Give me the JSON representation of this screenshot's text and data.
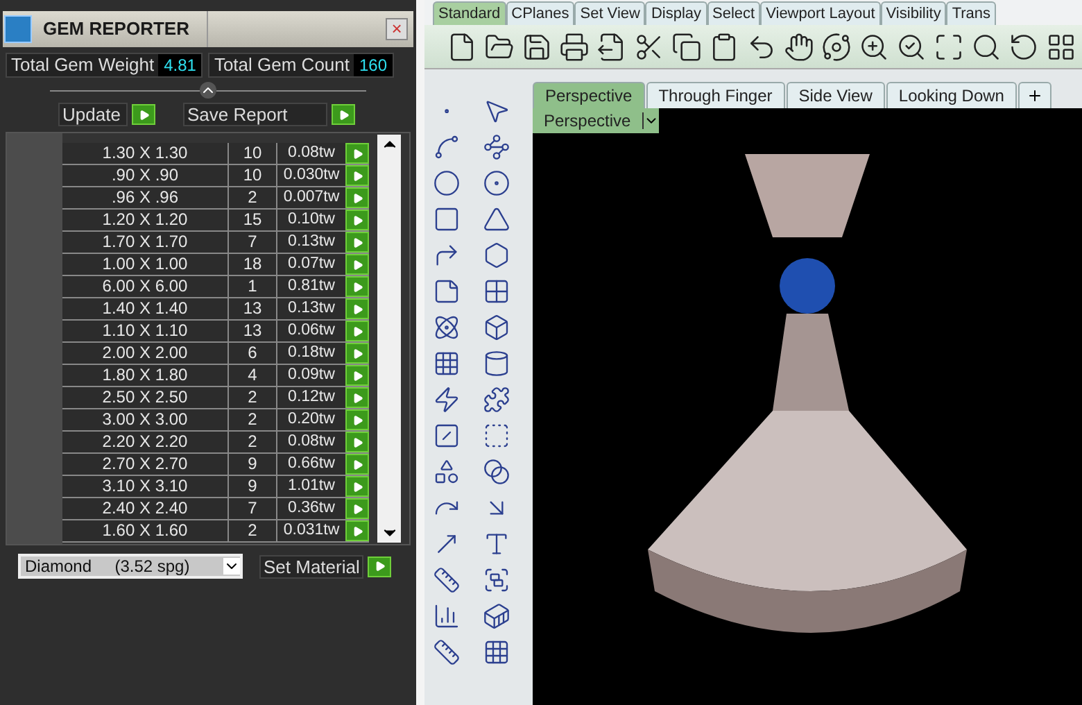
{
  "gem_panel": {
    "title": "GEM REPORTER",
    "close": "×",
    "totals": [
      {
        "label": "Total Gem Weight",
        "value": "4.81"
      },
      {
        "label": "Total Gem Count",
        "value": "160"
      }
    ],
    "actions": [
      "Update",
      "Save Report"
    ],
    "rows": [
      {
        "size": "1.30 X 1.30",
        "count": "10",
        "weight": "0.08tw"
      },
      {
        "size": ".90 X .90",
        "count": "10",
        "weight": "0.030tw"
      },
      {
        "size": ".96 X .96",
        "count": "2",
        "weight": "0.007tw"
      },
      {
        "size": "1.20 X 1.20",
        "count": "15",
        "weight": "0.10tw"
      },
      {
        "size": "1.70 X 1.70",
        "count": "7",
        "weight": "0.13tw"
      },
      {
        "size": "1.00 X 1.00",
        "count": "18",
        "weight": "0.07tw"
      },
      {
        "size": "6.00 X 6.00",
        "count": "1",
        "weight": "0.81tw"
      },
      {
        "size": "1.40 X 1.40",
        "count": "13",
        "weight": "0.13tw"
      },
      {
        "size": "1.10 X 1.10",
        "count": "13",
        "weight": "0.06tw"
      },
      {
        "size": "2.00 X 2.00",
        "count": "6",
        "weight": "0.18tw"
      },
      {
        "size": "1.80 X 1.80",
        "count": "4",
        "weight": "0.09tw"
      },
      {
        "size": "2.50 X 2.50",
        "count": "2",
        "weight": "0.12tw"
      },
      {
        "size": "3.00 X 3.00",
        "count": "2",
        "weight": "0.20tw"
      },
      {
        "size": "2.20 X 2.20",
        "count": "2",
        "weight": "0.08tw"
      },
      {
        "size": "2.70 X 2.70",
        "count": "9",
        "weight": "0.66tw"
      },
      {
        "size": "3.10 X 3.10",
        "count": "9",
        "weight": "1.01tw"
      },
      {
        "size": "2.40 X 2.40",
        "count": "7",
        "weight": "0.36tw"
      },
      {
        "size": "1.60 X 1.60",
        "count": "2",
        "weight": "0.031tw"
      }
    ],
    "material": {
      "value": "Diamond     (3.52 spg)",
      "button": "Set Material"
    }
  },
  "toolbar_tabs": [
    {
      "label": "Standard",
      "selected": true
    },
    {
      "label": "CPlanes",
      "selected": false
    },
    {
      "label": "Set View",
      "selected": false
    },
    {
      "label": "Display",
      "selected": false
    },
    {
      "label": "Select",
      "selected": false
    },
    {
      "label": "Viewport Layout",
      "selected": false
    },
    {
      "label": "Visibility",
      "selected": false
    },
    {
      "label": "Trans",
      "selected": false
    }
  ],
  "viewport_tabs": [
    {
      "label": "Perspective",
      "selected": true
    },
    {
      "label": "Through Finger",
      "selected": false
    },
    {
      "label": "Side View",
      "selected": false
    },
    {
      "label": "Looking Down",
      "selected": false
    }
  ],
  "viewport": {
    "label": "Perspective"
  }
}
